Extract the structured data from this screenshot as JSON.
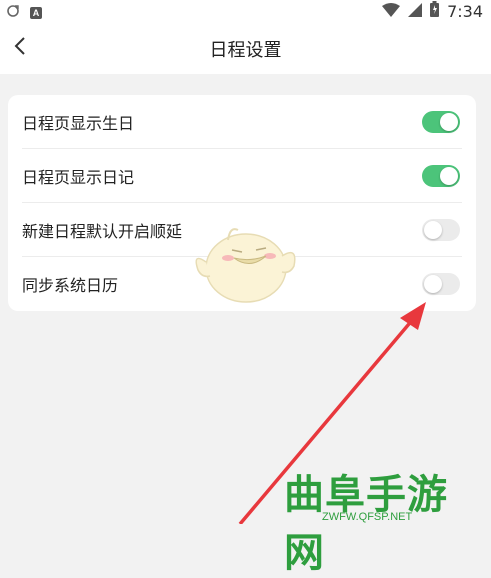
{
  "status_bar": {
    "time": "7:34",
    "notification_badge": "A",
    "icons": [
      "sync-icon",
      "notification-a-icon",
      "wifi-icon",
      "signal-icon",
      "battery-icon"
    ]
  },
  "header": {
    "title": "日程设置",
    "back_icon": "chevron-left-icon"
  },
  "settings": [
    {
      "label": "日程页显示生日",
      "enabled": true
    },
    {
      "label": "日程页显示日记",
      "enabled": true
    },
    {
      "label": "新建日程默认开启顺延",
      "enabled": false
    },
    {
      "label": "同步系统日历",
      "enabled": false
    }
  ],
  "watermark": {
    "title": "曲阜手游网",
    "url": "ZWFW.QFSP.NET"
  },
  "colors": {
    "toggle_on": "#4cc47a",
    "toggle_off": "#ebebeb",
    "arrow": "#e8383d",
    "watermark": "#2e9e3e"
  }
}
